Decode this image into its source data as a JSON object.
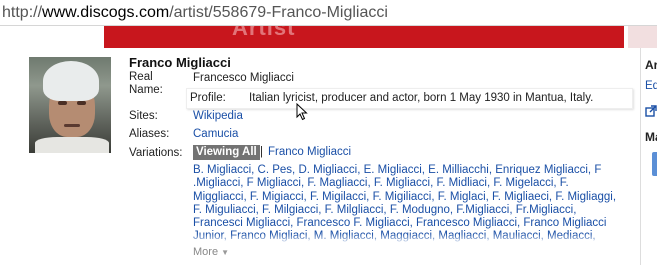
{
  "browser": {
    "url_prefix": "http://",
    "url_host": "www.discogs.com",
    "url_path": "/artist/558679-Franco-Migliacci"
  },
  "header": {
    "banner_ghost_text": "Artist"
  },
  "artist": {
    "name": "Franco Migliacci",
    "real_name_label": "Real Name:",
    "real_name": "Francesco Migliacci",
    "profile_label": "Profile:",
    "profile": "Italian lyricist, producer and actor, born 1 May 1930 in Mantua, Italy.",
    "sites_label": "Sites:",
    "sites": [
      "Wikipedia"
    ],
    "aliases_label": "Aliases:",
    "aliases": [
      "Camucia"
    ],
    "variations_label": "Variations:",
    "viewing_all_label": "Viewing All",
    "variation_filter": "Franco Migliacci",
    "variations_text": "B. Migliacci, C. Pes, D. Migliacci, E. Migliacci, E. Milliacchi, Enriquez Migliacci, F .Migliacci, F Migliacci, F. Magliacci, F. Migliacci, F. Midliaci, F. Migelacci, F. Miggliacci, F. Migiacci, F. Migilacci, F. Migiliacci, F. Miglaci, F. Migliaeci, F. Migliaggi, F. Miguliacci, F. Milgiacci, F. Milgliacci, F. Modugno, F.Migliacci, Fr.Migliacci, Francesci Migliacci, Francesco F. Migliacci, Francesco Migliacci, Franco Migliacci Junior, Franco Migliaci, M. Migliacci, Maggiacci, Magliacci, Mauliacci, Mediacci, Migliaccio, Migliacci, Migliacci F.",
    "more_label": "More"
  },
  "sidebar": {
    "heading_1": "Ar",
    "link_1": "Ed",
    "heading_2": "Ma"
  },
  "colors": {
    "brand_red": "#c8161d",
    "link_blue": "#1a4fa6",
    "viewing_all_bg": "#737373"
  }
}
